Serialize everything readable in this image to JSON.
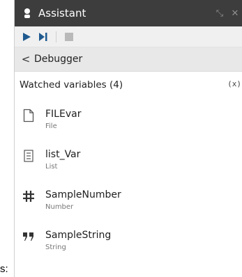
{
  "fragment": "s:",
  "window": {
    "title": "Assistant"
  },
  "toolbar": {
    "run_icon": "play-icon",
    "step_icon": "step-icon",
    "stop_icon": "stop-icon"
  },
  "nav": {
    "back_glyph": "<",
    "title": "Debugger"
  },
  "section": {
    "title": "Watched variables (4)",
    "variable_icon_text": "(x)"
  },
  "variables": [
    {
      "name": "FILEvar",
      "type": "File",
      "icon": "file-icon"
    },
    {
      "name": "list_Var",
      "type": "List",
      "icon": "list-icon"
    },
    {
      "name": "SampleNumber",
      "type": "Number",
      "icon": "hash-icon"
    },
    {
      "name": "SampleString",
      "type": "String",
      "icon": "quote-icon"
    }
  ],
  "colors": {
    "titlebar": "#3d3d3d",
    "accent": "#1f5a8f",
    "toolbar": "#f0f0f0",
    "navbar": "#e8e8e8"
  }
}
